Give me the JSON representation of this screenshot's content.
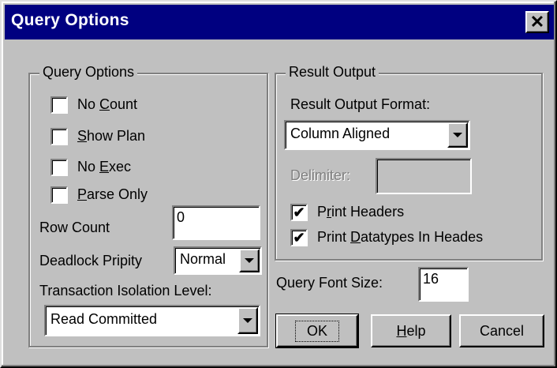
{
  "window": {
    "title": "Query Options"
  },
  "query_options": {
    "legend": "Query Options",
    "checkboxes": [
      {
        "pre": "No ",
        "mnemonic": "C",
        "post": "ount",
        "checked": false
      },
      {
        "pre": "",
        "mnemonic": "S",
        "post": "how Plan",
        "checked": false
      },
      {
        "pre": "No ",
        "mnemonic": "E",
        "post": "xec",
        "checked": false
      },
      {
        "pre": "",
        "mnemonic": "P",
        "post": "arse Only",
        "checked": false
      }
    ],
    "row_count_label": "Row Count",
    "row_count_value": "0",
    "deadlock_label": "Deadlock Pripity",
    "deadlock_value": "Normal",
    "isolation_label": "Transaction Isolation Level:",
    "isolation_value": "Read Committed"
  },
  "result_output": {
    "legend": "Result Output",
    "format_label": "Result Output Format:",
    "format_value": "Column Aligned",
    "delimiter_label": "Delimiter:",
    "delimiter_value": "",
    "print_headers": {
      "pre": "P",
      "mnemonic": "r",
      "post": "int Headers",
      "checked": true
    },
    "print_datatypes": {
      "pre": "Print ",
      "mnemonic": "D",
      "post": "atatypes In Heades",
      "checked": true
    }
  },
  "font_size": {
    "label": "Query Font Size:",
    "value": "16"
  },
  "buttons": {
    "ok": "OK",
    "help_mnemonic": "H",
    "help_rest": "elp",
    "cancel": "Cancel"
  },
  "glyphs": {
    "check": "✔",
    "close": "✕"
  }
}
